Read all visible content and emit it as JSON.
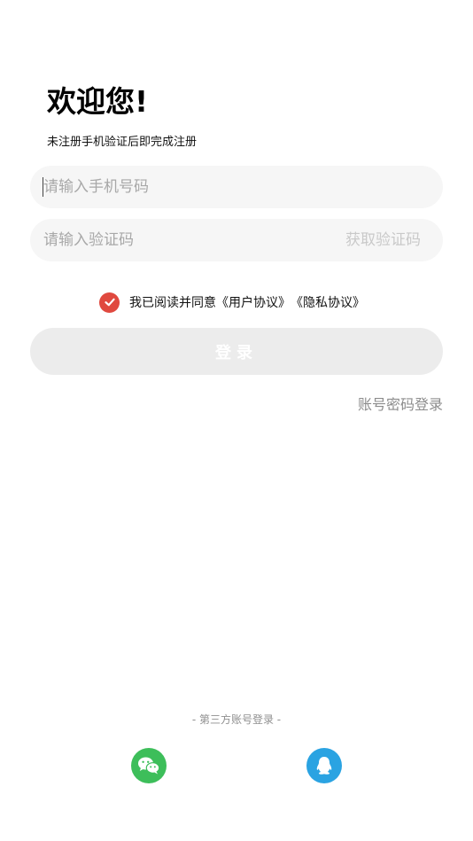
{
  "header": {
    "title": "欢迎您!",
    "subtitle": "未注册手机验证后即完成注册"
  },
  "form": {
    "phone_placeholder": "请输入手机号码",
    "code_placeholder": "请输入验证码",
    "get_code_label": "获取验证码",
    "login_label": "登录"
  },
  "agreement": {
    "checked": true,
    "text": "我已阅读并同意",
    "user_agreement": "《用户协议》",
    "privacy_agreement": "《隐私协议》"
  },
  "links": {
    "password_login": "账号密码登录"
  },
  "third_party": {
    "title": "- 第三方账号登录 -",
    "wechat_icon": "wechat-icon",
    "qq_icon": "qq-icon"
  },
  "colors": {
    "check": "#e0493f",
    "wechat": "#3dbe5a",
    "qq": "#2aa3e2"
  }
}
